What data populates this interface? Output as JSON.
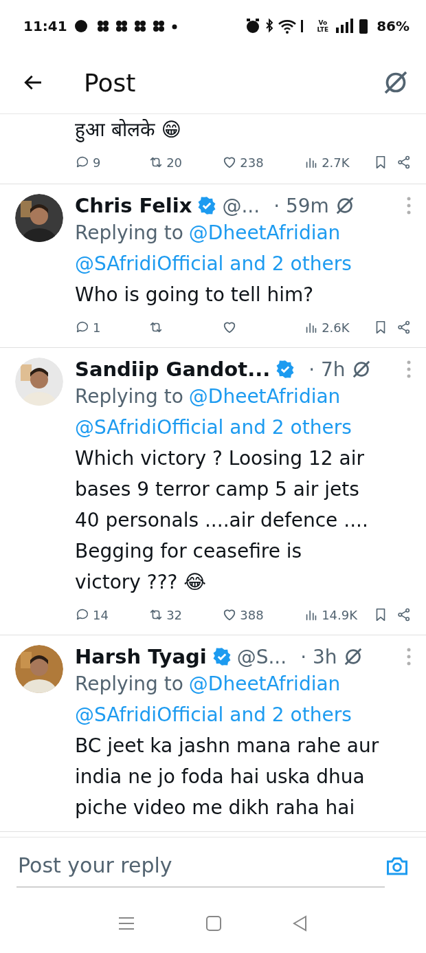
{
  "status_bar": {
    "time": "11:41",
    "network_label": [
      "Vo",
      "LTE"
    ],
    "battery": "86%"
  },
  "header": {
    "title": "Post"
  },
  "posts": [
    {
      "kind": "tail",
      "text": "हुआ बोलके 😁",
      "stats": {
        "replies": "9",
        "reposts": "20",
        "likes": "238",
        "views": "2.7K"
      }
    },
    {
      "kind": "reply",
      "name": "Chris Felix",
      "handle": "@...",
      "time": "· 59m",
      "replying_prefix": "Replying to",
      "replying_to": [
        "@DheetAfridian",
        "@SAfridiOfficial and 2 others"
      ],
      "text": [
        "Who is going to tell him?"
      ],
      "stats": {
        "replies": "1",
        "views": "2.6K"
      }
    },
    {
      "kind": "reply",
      "name": "Sandiip Gandot...",
      "time": "· 7h",
      "replying_prefix": "Replying to",
      "replying_to": [
        "@DheetAfridian",
        "@SAfridiOfficial and 2 others"
      ],
      "text": [
        "Which victory ? Loosing 12 air",
        "bases 9 terror camp 5 air jets",
        "40 personals ....air defence ....",
        "Begging for ceasefire is",
        "victory ??? 😂"
      ],
      "stats": {
        "replies": "14",
        "reposts": "32",
        "likes": "388",
        "views": "14.9K"
      }
    },
    {
      "kind": "reply",
      "name": "Harsh Tyagi",
      "handle": "@S...",
      "time": "· 3h",
      "replying_prefix": "Replying to",
      "replying_to": [
        "@DheetAfridian",
        "@SAfridiOfficial and 2 others"
      ],
      "text": [
        "BC jeet ka jashn mana rahe aur",
        "india ne jo foda hai uska dhua",
        "piche video me dikh raha hai"
      ]
    }
  ],
  "reply_bar": {
    "placeholder": "Post your reply"
  }
}
